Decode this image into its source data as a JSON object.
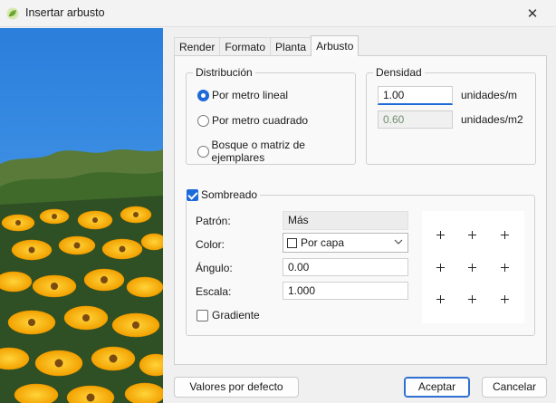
{
  "window": {
    "title": "Insertar arbusto",
    "app_icon": "leaf-app-icon",
    "close_icon": "close-icon"
  },
  "tabs": [
    {
      "label": "Render",
      "active": false
    },
    {
      "label": "Formato",
      "active": false
    },
    {
      "label": "Planta",
      "active": false
    },
    {
      "label": "Arbusto",
      "active": true
    }
  ],
  "distribucion": {
    "legend": "Distribución",
    "options": [
      {
        "label": "Por metro lineal",
        "selected": true
      },
      {
        "label": "Por metro cuadrado",
        "selected": false
      },
      {
        "label": "Bosque o matriz de ejemplares",
        "selected": false
      }
    ]
  },
  "densidad": {
    "legend": "Densidad",
    "linear_value": "1.00",
    "linear_unit": "unidades/m",
    "square_value": "0.60",
    "square_unit": "unidades/m2"
  },
  "sombreado": {
    "label": "Sombreado",
    "checked": true,
    "patron_label": "Patrón:",
    "patron_value": "Más",
    "color_label": "Color:",
    "color_value": "Por capa",
    "angulo_label": "Ángulo:",
    "angulo_value": "0.00",
    "escala_label": "Escala:",
    "escala_value": "1.000",
    "gradiente_label": "Gradiente",
    "gradiente_checked": false
  },
  "buttons": {
    "defaults": "Valores por defecto",
    "accept": "Aceptar",
    "cancel": "Cancelar"
  },
  "colors": {
    "accent": "#1d6ad8",
    "sky": "#2f86e0",
    "flower": "#f7b500"
  }
}
